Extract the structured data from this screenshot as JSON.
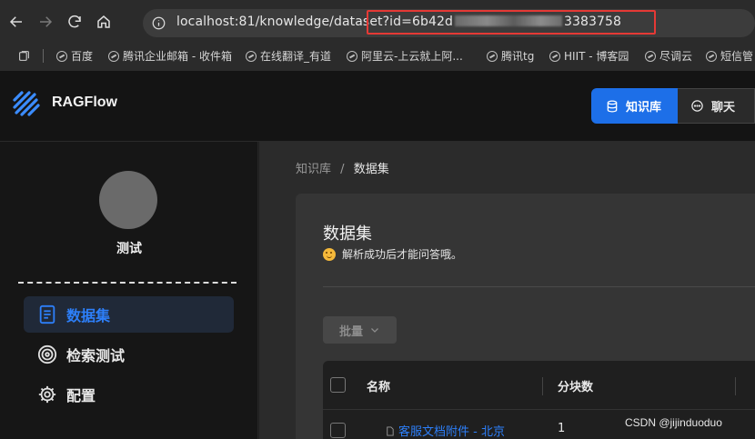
{
  "browser": {
    "url_host": "localhost:81/knowledge/dataset",
    "url_query_start": "?id=6b42d",
    "url_query_end": "3383758",
    "icons": [
      "back-icon",
      "forward-icon",
      "reload-icon",
      "home-icon",
      "info-icon"
    ],
    "highlight_color": "#e53935",
    "bookmarks": [
      "百度",
      "腾讯企业邮箱 - 收件箱",
      "在线翻译_有道",
      "阿里云-上云就上阿...",
      "腾讯tg",
      "HIIT - 博客园",
      "尽调云",
      "短信管"
    ]
  },
  "app": {
    "name": "RAGFlow",
    "nav": {
      "knowledge": "知识库",
      "chat": "聊天"
    },
    "accent": "#1d6fe8"
  },
  "sidebar": {
    "kb_name": "测试",
    "items": [
      {
        "label": "数据集",
        "icon": "document-icon",
        "active": true
      },
      {
        "label": "检索测试",
        "icon": "target-icon",
        "active": false
      },
      {
        "label": "配置",
        "icon": "gear-icon",
        "active": false
      }
    ]
  },
  "main": {
    "breadcrumb": {
      "root": "知识库",
      "sep": "/",
      "current": "数据集"
    },
    "title": "数据集",
    "tip": "解析成功后才能问答哦。",
    "bulk_button": "批量",
    "table": {
      "columns": [
        "名称",
        "分块数"
      ],
      "rows": [
        {
          "name": "客服文档附件 - 北京",
          "chunks": "1"
        }
      ]
    }
  },
  "watermark": "CSDN @jijinduoduo"
}
